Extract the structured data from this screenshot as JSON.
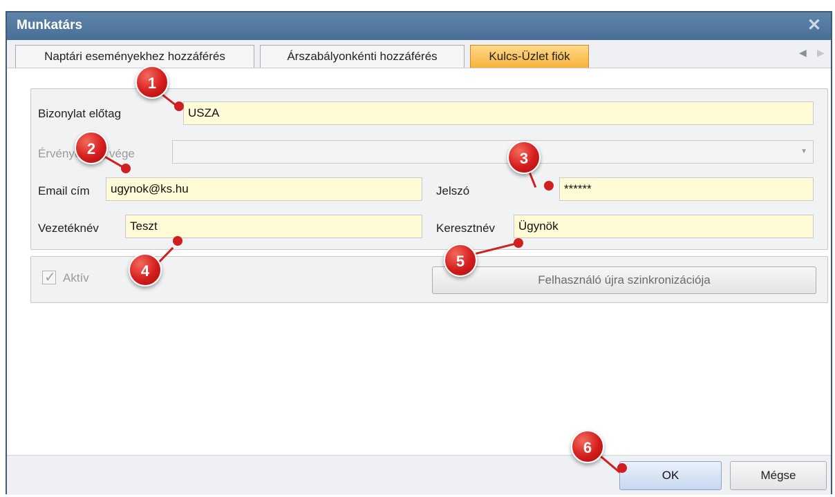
{
  "window": {
    "title": "Munkatárs",
    "close_glyph": "✕"
  },
  "tabs": [
    {
      "label": "Naptári eseményekhez hozzáférés",
      "active": false
    },
    {
      "label": "Árszabályonkénti hozzáférés",
      "active": false
    },
    {
      "label": "Kulcs-Üzlet fiók",
      "active": true
    }
  ],
  "tab_nav": {
    "prev_icon": "◀",
    "next_icon": "▶"
  },
  "form": {
    "prefix_label": "Bizonylat előtag",
    "prefix_value": "USZA",
    "validity_label": "Érvényesség vége",
    "validity_value": "",
    "email_label": "Email cím",
    "email_value": "ugynok@ks.hu",
    "password_label": "Jelszó",
    "password_value": "******",
    "lastname_label": "Vezetéknév",
    "lastname_value": "Teszt",
    "firstname_label": "Keresztnév",
    "firstname_value": "Ügynök"
  },
  "status": {
    "active_label": "Aktív",
    "active_checked": true,
    "sync_button": "Felhasználó újra szinkronizációja"
  },
  "footer": {
    "ok_button": "OK",
    "cancel_button": "Mégse"
  },
  "annotations": [
    "1",
    "2",
    "3",
    "4",
    "5",
    "6"
  ],
  "colors": {
    "title_bar": "#4f76a0",
    "active_tab": "#f9b94d",
    "field_bg": "#fffbd6",
    "annotation": "#d11f1f"
  }
}
